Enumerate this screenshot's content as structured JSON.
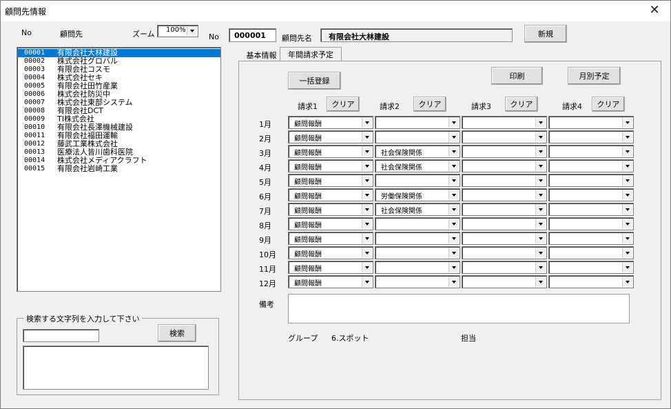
{
  "window": {
    "title": "顧問先情報",
    "close": "✕"
  },
  "header": {
    "no_label": "No",
    "client_label": "顧問先",
    "zoom_label": "ズーム",
    "zoom_value": "100%",
    "no_label2": "No",
    "client_no": "000001",
    "client_name_label": "顧問先名",
    "client_name": "有限会社大林建設",
    "new_button": "新規"
  },
  "client_list": [
    {
      "no": "00001",
      "name": "有限会社大林建設",
      "selected": true
    },
    {
      "no": "00002",
      "name": "株式会社グロバル"
    },
    {
      "no": "00003",
      "name": "有限会社コスモ"
    },
    {
      "no": "00004",
      "name": "株式会社セキ"
    },
    {
      "no": "00005",
      "name": "有限会社田竹産業"
    },
    {
      "no": "00006",
      "name": "株式会社防災中"
    },
    {
      "no": "00007",
      "name": "株式会社東部システム"
    },
    {
      "no": "00008",
      "name": "有限会社DCT"
    },
    {
      "no": "00009",
      "name": "TI株式会社"
    },
    {
      "no": "00010",
      "name": "有限会社長澤機械建設"
    },
    {
      "no": "00011",
      "name": "有限会社福田運輸"
    },
    {
      "no": "00012",
      "name": "藤武工業株式会社"
    },
    {
      "no": "00013",
      "name": "医療法人皆川歯科医院"
    },
    {
      "no": "00014",
      "name": "株式会社メディアクラフト"
    },
    {
      "no": "00015",
      "name": "有限会社岩崎工業"
    }
  ],
  "search": {
    "legend": "検索する文字列を入力して下さい",
    "input_value": "",
    "button": "検索"
  },
  "tabs": [
    {
      "label": "基本情報",
      "active": false
    },
    {
      "label": "年間請求予定",
      "active": true
    }
  ],
  "billing": {
    "bulk_register": "一括登録",
    "print": "印刷",
    "monthly_plan": "月別予定",
    "clear": "クリア",
    "columns": [
      "請求1",
      "請求2",
      "請求3",
      "請求4"
    ],
    "rows": [
      {
        "month": "1月",
        "c1": "顧問報酬",
        "c2": "",
        "c3": "",
        "c4": ""
      },
      {
        "month": "2月",
        "c1": "顧問報酬",
        "c2": "",
        "c3": "",
        "c4": ""
      },
      {
        "month": "3月",
        "c1": "顧問報酬",
        "c2": "社会保険関係",
        "c3": "",
        "c4": ""
      },
      {
        "month": "4月",
        "c1": "顧問報酬",
        "c2": "社会保険関係",
        "c3": "",
        "c4": ""
      },
      {
        "month": "5月",
        "c1": "顧問報酬",
        "c2": "",
        "c3": "",
        "c4": ""
      },
      {
        "month": "6月",
        "c1": "顧問報酬",
        "c2": "労働保険関係",
        "c3": "",
        "c4": ""
      },
      {
        "month": "7月",
        "c1": "顧問報酬",
        "c2": "社会保険関係",
        "c3": "",
        "c4": ""
      },
      {
        "month": "8月",
        "c1": "顧問報酬",
        "c2": "",
        "c3": "",
        "c4": ""
      },
      {
        "month": "9月",
        "c1": "顧問報酬",
        "c2": "",
        "c3": "",
        "c4": ""
      },
      {
        "month": "10月",
        "c1": "顧問報酬",
        "c2": "",
        "c3": "",
        "c4": ""
      },
      {
        "month": "11月",
        "c1": "顧問報酬",
        "c2": "",
        "c3": "",
        "c4": ""
      },
      {
        "month": "12月",
        "c1": "顧問報酬",
        "c2": "",
        "c3": "",
        "c4": ""
      }
    ],
    "memo_label": "備考",
    "memo_value": "",
    "group_label": "グループ",
    "group_value": "6.スポット",
    "staff_label": "担当",
    "staff_value": ""
  }
}
